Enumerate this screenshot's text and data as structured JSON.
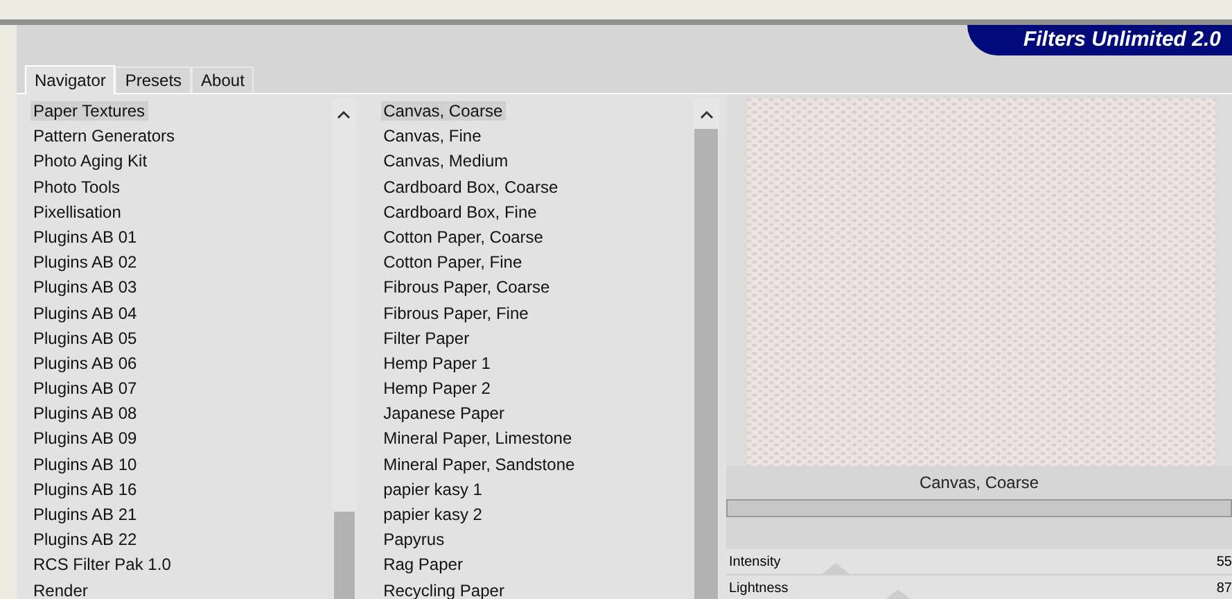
{
  "window": {
    "title": "Filters Unlimited 2.0"
  },
  "tabs": [
    {
      "label": "Navigator",
      "selected": true
    },
    {
      "label": "Presets",
      "selected": false
    },
    {
      "label": "About",
      "selected": false
    }
  ],
  "categories": [
    {
      "label": "Paper Textures",
      "selected": true
    },
    {
      "label": "Pattern Generators",
      "selected": false
    },
    {
      "label": "Photo Aging Kit",
      "selected": false
    },
    {
      "label": "Photo Tools",
      "selected": false
    },
    {
      "label": "Pixellisation",
      "selected": false
    },
    {
      "label": "Plugins AB 01",
      "selected": false
    },
    {
      "label": "Plugins AB 02",
      "selected": false
    },
    {
      "label": "Plugins AB 03",
      "selected": false
    },
    {
      "label": "Plugins AB 04",
      "selected": false
    },
    {
      "label": "Plugins AB 05",
      "selected": false
    },
    {
      "label": "Plugins AB 06",
      "selected": false
    },
    {
      "label": "Plugins AB 07",
      "selected": false
    },
    {
      "label": "Plugins AB 08",
      "selected": false
    },
    {
      "label": "Plugins AB 09",
      "selected": false
    },
    {
      "label": "Plugins AB 10",
      "selected": false
    },
    {
      "label": "Plugins AB 16",
      "selected": false
    },
    {
      "label": "Plugins AB 21",
      "selected": false
    },
    {
      "label": "Plugins AB 22",
      "selected": false
    },
    {
      "label": "RCS Filter Pak 1.0",
      "selected": false
    },
    {
      "label": "Render",
      "selected": false
    }
  ],
  "filters": [
    {
      "label": "Canvas, Coarse",
      "selected": true
    },
    {
      "label": "Canvas, Fine",
      "selected": false
    },
    {
      "label": "Canvas, Medium",
      "selected": false
    },
    {
      "label": "Cardboard Box, Coarse",
      "selected": false
    },
    {
      "label": "Cardboard Box, Fine",
      "selected": false
    },
    {
      "label": "Cotton Paper, Coarse",
      "selected": false
    },
    {
      "label": "Cotton Paper, Fine",
      "selected": false
    },
    {
      "label": "Fibrous Paper, Coarse",
      "selected": false
    },
    {
      "label": "Fibrous Paper, Fine",
      "selected": false
    },
    {
      "label": "Filter Paper",
      "selected": false
    },
    {
      "label": "Hemp Paper 1",
      "selected": false
    },
    {
      "label": "Hemp Paper 2",
      "selected": false
    },
    {
      "label": "Japanese Paper",
      "selected": false
    },
    {
      "label": "Mineral Paper, Limestone",
      "selected": false
    },
    {
      "label": "Mineral Paper, Sandstone",
      "selected": false
    },
    {
      "label": "papier kasy 1",
      "selected": false
    },
    {
      "label": "papier kasy 2",
      "selected": false
    },
    {
      "label": "Papyrus",
      "selected": false
    },
    {
      "label": "Rag Paper",
      "selected": false
    },
    {
      "label": "Recycling Paper",
      "selected": false
    }
  ],
  "preview": {
    "caption": "Canvas, Coarse"
  },
  "sliders": [
    {
      "label": "Intensity",
      "value": "55",
      "level": 0.216
    },
    {
      "label": "Lightness",
      "value": "87",
      "level": 0.341
    }
  ]
}
